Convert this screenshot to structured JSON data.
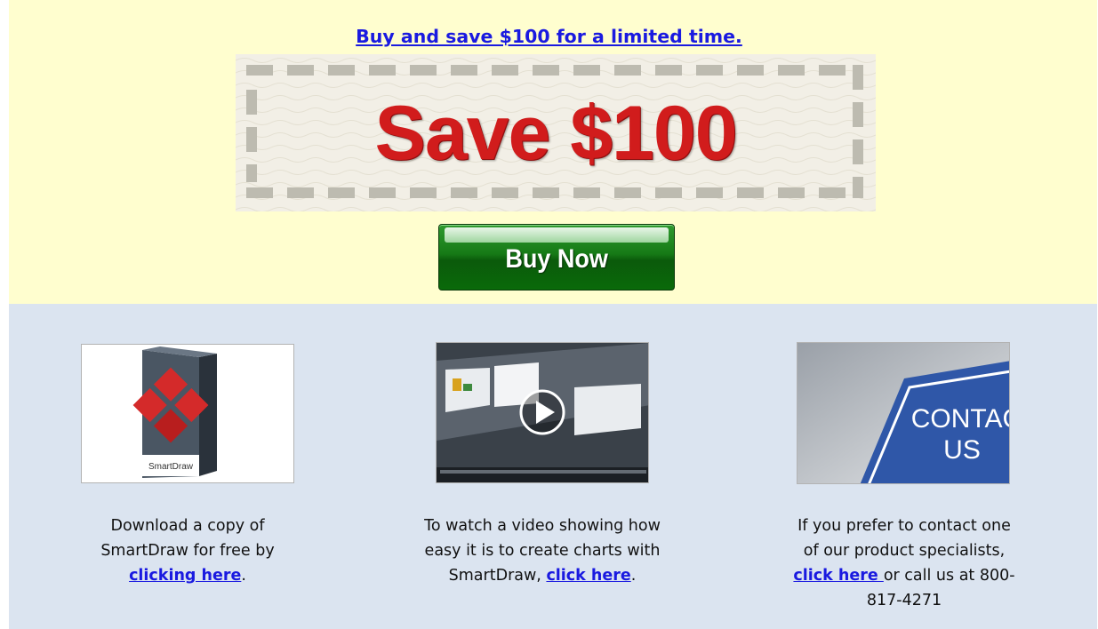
{
  "promo": {
    "headline": "Buy and save $100 for a limited time.",
    "coupon_text": "Save $100",
    "buy_button": "Buy Now"
  },
  "columns": [
    {
      "text_1": "Download a copy of",
      "text_2": "SmartDraw for free by",
      "link": "clicking here",
      "text_after": ".",
      "image_label": "SmartDraw"
    },
    {
      "text_1": "To watch a video showing how",
      "text_2": "easy it is to create charts with",
      "text_3": "SmartDraw, ",
      "link": "click here",
      "text_after": "."
    },
    {
      "text_1": "If you prefer to contact one",
      "text_2": "of our product specialists,",
      "link": "click here ",
      "text_after": " or call us at 800-",
      "text_4": "817-4271",
      "image_line_1": "CONTAC",
      "image_line_2": "US"
    }
  ],
  "colors": {
    "promo_bg": "#fffecf",
    "info_bg": "#dbe4f0",
    "link": "#1a1ae0",
    "coupon_red": "#d11c1c",
    "button_green": "#167a16"
  }
}
